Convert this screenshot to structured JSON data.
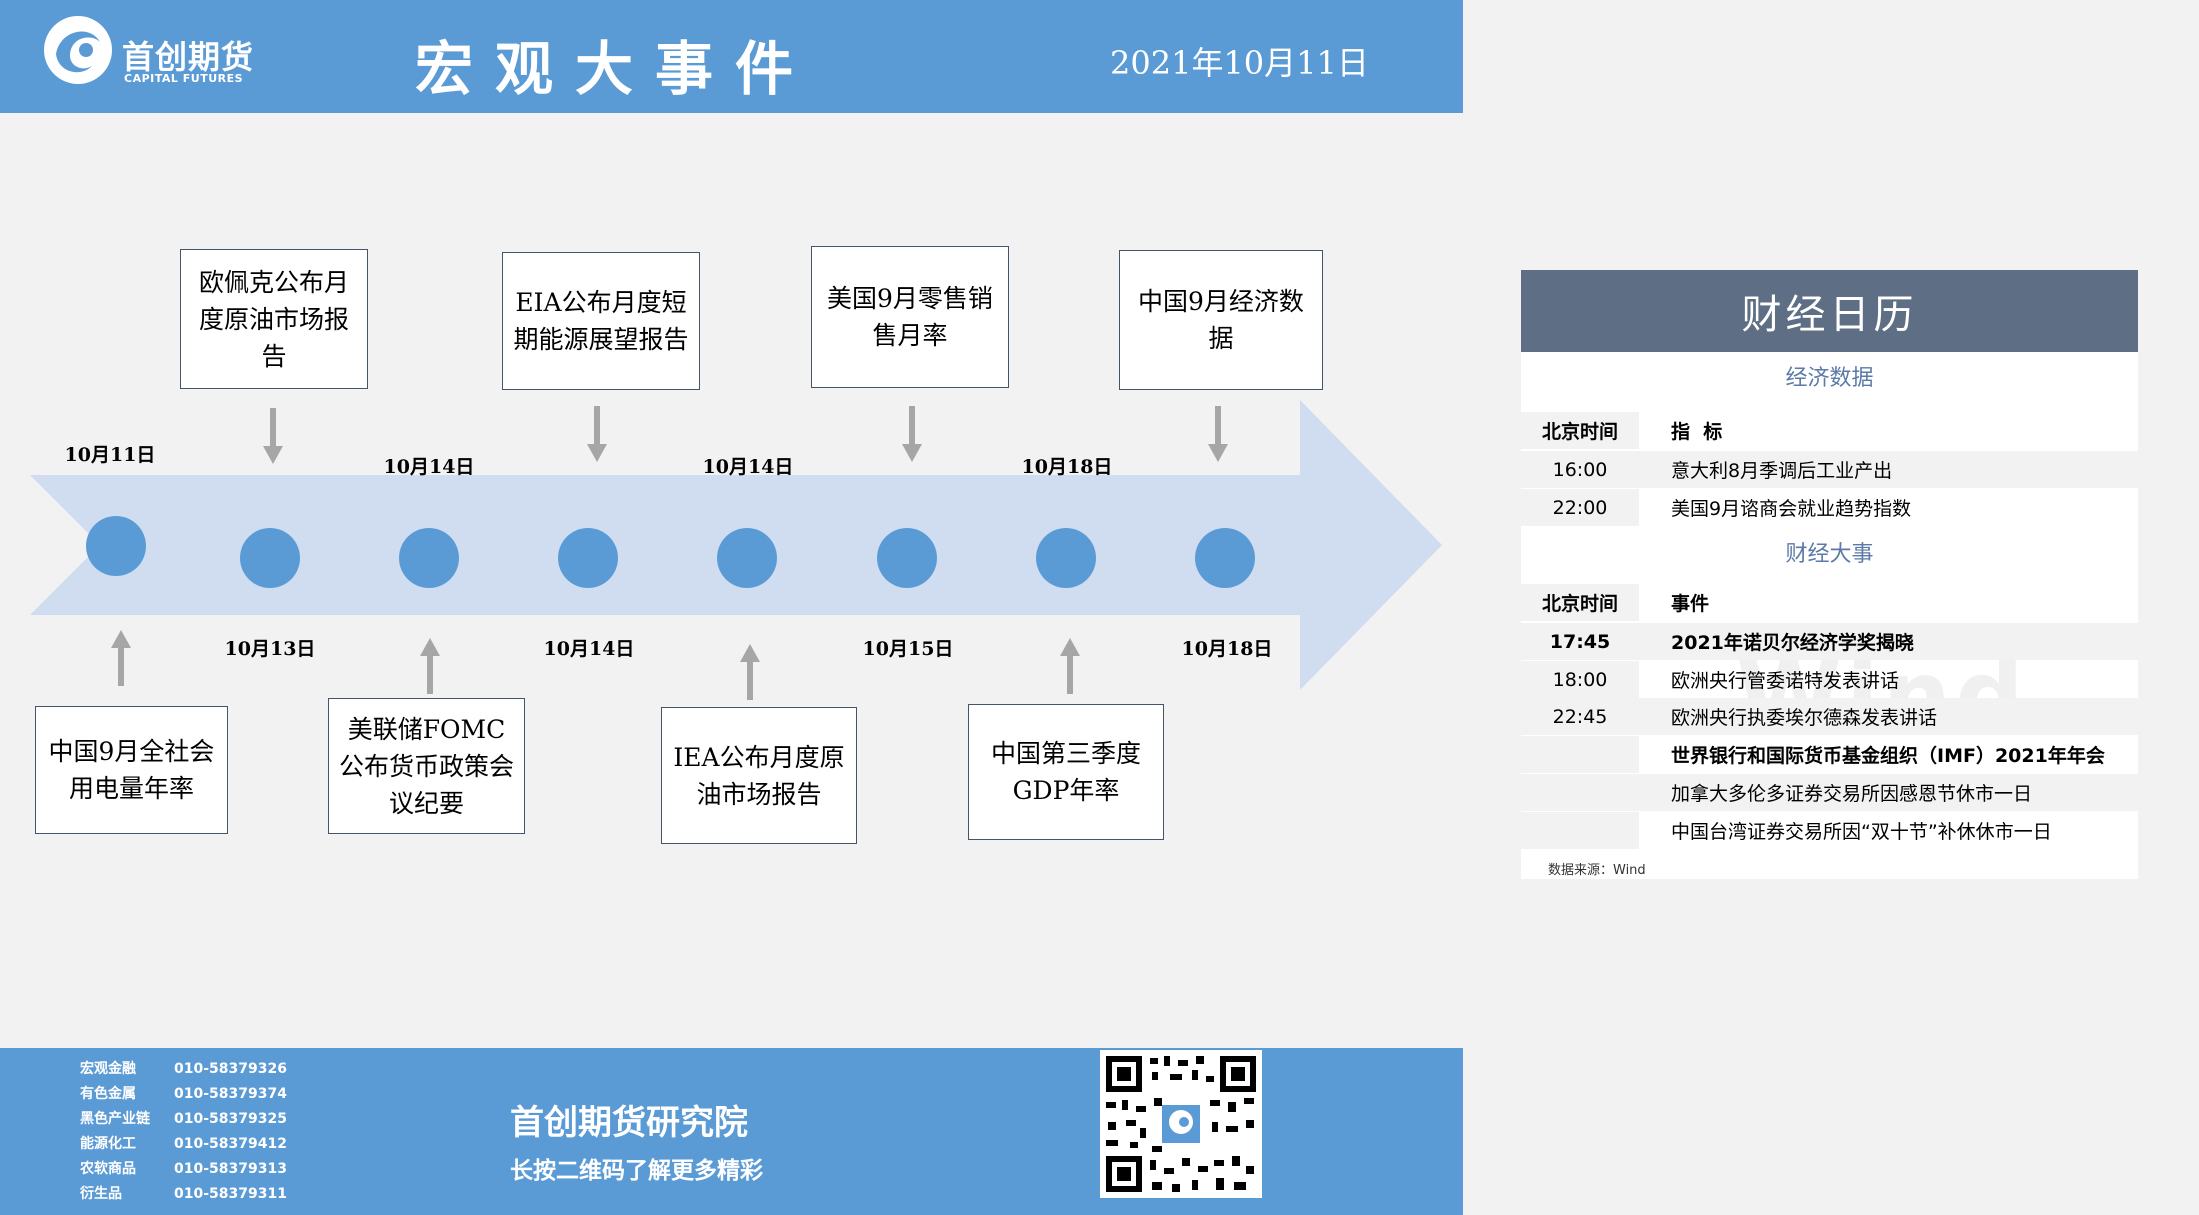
{
  "header": {
    "logo_cn": "首创期货",
    "logo_en": "CAPITAL FUTURES",
    "title": "宏观大事件",
    "date": "2021年10月11日"
  },
  "timeline": {
    "above": [
      {
        "date": "10月11日",
        "event": null
      },
      {
        "date": "10月14日",
        "event": null
      },
      {
        "date": "10月14日",
        "event": null
      },
      {
        "date": "10月14日",
        "event": null
      },
      {
        "date": "10月18日",
        "event": null
      }
    ],
    "top_events": [
      "欧佩克公布月度原油市场报告",
      "EIA公布月度短期能源展望报告",
      "美国9月零售销售月率",
      "中国9月经济数据"
    ],
    "top_dates": [
      "10月14日",
      "10月14日",
      "10月18日"
    ],
    "first_date": "10月11日",
    "bottom_dates": [
      "10月13日",
      "10月14日",
      "10月15日",
      "10月18日"
    ],
    "bottom_events": [
      "中国9月全社会用电量年率",
      "美联储FOMC公布货币政策会议纪要",
      "IEA公布月度原油市场报告",
      "中国第三季度GDP年率"
    ]
  },
  "calendar": {
    "title": "财经日历",
    "section1": "经济数据",
    "section2": "财经大事",
    "col_time": "北京时间",
    "col_indicator": "指  标",
    "col_event": "事件",
    "data_rows": [
      {
        "time": "16:00",
        "item": "意大利8月季调后工业产出"
      },
      {
        "time": "22:00",
        "item": "美国9月谘商会就业趋势指数"
      }
    ],
    "event_rows": [
      {
        "time": "17:45",
        "item": "2021年诺贝尔经济学奖揭晓"
      },
      {
        "time": "18:00",
        "item": "欧洲央行管委诺特发表讲话"
      },
      {
        "time": "22:45",
        "item": "欧洲央行执委埃尔德森发表讲话"
      },
      {
        "time": "",
        "item": "世界银行和国际货币基金组织（IMF）2021年年会"
      },
      {
        "time": "",
        "item": "加拿大多伦多证券交易所因感恩节休市一日"
      },
      {
        "time": "",
        "item": "中国台湾证券交易所因“双十节”补休休市一日"
      }
    ],
    "source": "数据来源：Wind",
    "watermark": "Wind"
  },
  "footer": {
    "contacts": [
      {
        "name": "宏观金融",
        "phone": "010-58379326"
      },
      {
        "name": "有色金属",
        "phone": "010-58379374"
      },
      {
        "name": "黑色产业链",
        "phone": "010-58379325"
      },
      {
        "name": "能源化工",
        "phone": "010-58379412"
      },
      {
        "name": "农软商品",
        "phone": "010-58379313"
      },
      {
        "name": "衍生品",
        "phone": "010-58379311"
      }
    ],
    "title": "首创期货研究院",
    "subtitle": "长按二维码了解更多精彩"
  },
  "colors": {
    "brand_blue": "#5b9bd5",
    "calendar_header": "#5e6e84",
    "arrow_fill": "#d0dcf0"
  }
}
